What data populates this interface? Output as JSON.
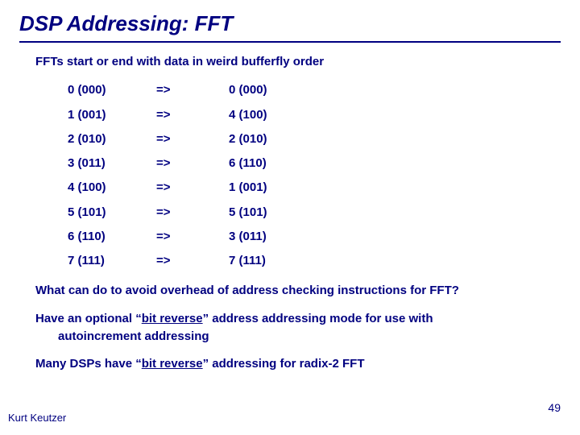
{
  "title": "DSP Addressing: FFT",
  "intro": "FFTs start or end with data in weird bufferfly order",
  "mappings": [
    {
      "in": "0 (000)",
      "arrow": "=>",
      "out": "0 (000)"
    },
    {
      "in": "1 (001)",
      "arrow": "=>",
      "out": "4 (100)"
    },
    {
      "in": "2 (010)",
      "arrow": "=>",
      "out": "2 (010)"
    },
    {
      "in": "3 (011)",
      "arrow": "=>",
      "out": "6 (110)"
    },
    {
      "in": "4 (100)",
      "arrow": "=>",
      "out": "1 (001)"
    },
    {
      "in": "5 (101)",
      "arrow": "=>",
      "out": "5 (101)"
    },
    {
      "in": "6 (110)",
      "arrow": "=>",
      "out": "3 (011)"
    },
    {
      "in": "7 (111)",
      "arrow": "=>",
      "out": "7 (111)"
    }
  ],
  "q": "What can do to avoid overhead of address checking instructions for FFT?",
  "ans": {
    "pre": "Have an optional “",
    "ul": "bit reverse",
    "post": "” address addressing mode for use with",
    "line2": "autoincrement addressing"
  },
  "many": {
    "pre": "Many DSPs have “",
    "ul": "bit reverse",
    "post": "” addressing for radix-2 FFT"
  },
  "footer": {
    "author": "Kurt Keutzer",
    "page": "49"
  }
}
